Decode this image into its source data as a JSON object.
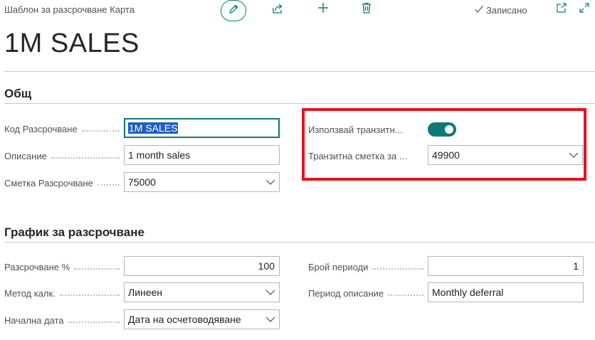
{
  "header": {
    "breadcrumb": "Шаблон за разсрочване Карта",
    "saved_label": "Записано",
    "title": "1M SALES"
  },
  "sections": {
    "general": {
      "title": "Общ",
      "code_label": "Код Разсрочване",
      "code_value": "1M SALES",
      "description_label": "Описание",
      "description_value": "1 month sales",
      "account_label": "Сметка Разсрочване",
      "account_value": "75000",
      "transit_toggle_label": "Използвай транзитн...",
      "transit_toggle_on": true,
      "transit_account_label": "Транзитна сметка за ...",
      "transit_account_value": "49900"
    },
    "schedule": {
      "title": "График за разсрочване",
      "percent_label": "Разсрочване %",
      "percent_value": "100",
      "calc_method_label": "Метод калк.",
      "calc_method_value": "Линеен",
      "start_date_label": "Начална дата",
      "start_date_value": "Дата на осчетоводяване",
      "periods_label": "Брой периоди",
      "periods_value": "1",
      "period_desc_label": "Период описание",
      "period_desc_value": "Monthly deferral"
    }
  },
  "colors": {
    "accent": "#0e7a75",
    "highlight_box": "#e8111c",
    "selection": "#1f5fbf"
  },
  "icons": [
    "edit-icon",
    "share-icon",
    "plus-icon",
    "delete-icon",
    "checkmark-icon",
    "open-new-window-icon",
    "expand-icon",
    "chevron-down-icon"
  ]
}
